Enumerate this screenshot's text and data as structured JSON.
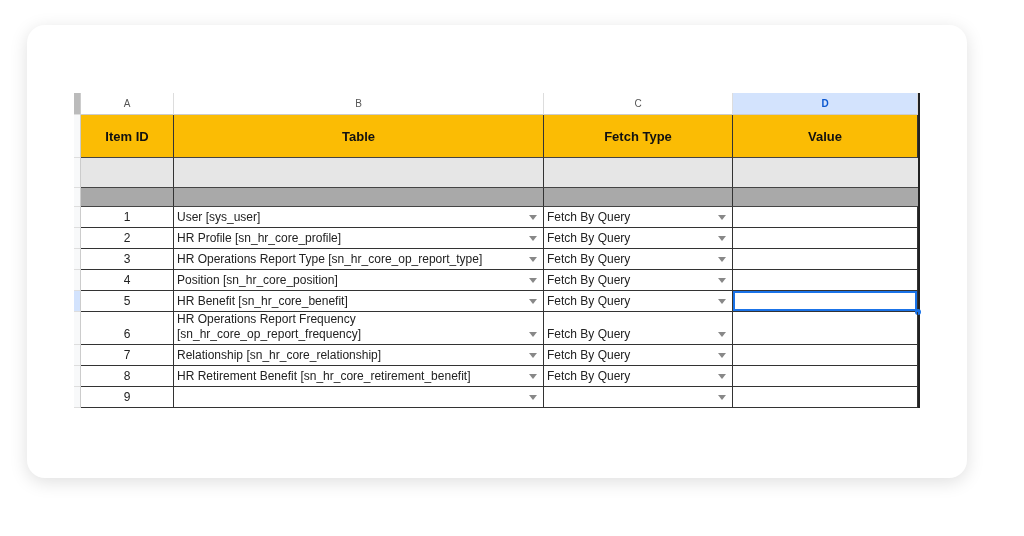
{
  "column_letters": [
    {
      "label": "A",
      "selected": false
    },
    {
      "label": "B",
      "selected": false
    },
    {
      "label": "C",
      "selected": false
    },
    {
      "label": "D",
      "selected": true
    }
  ],
  "header": [
    "Item ID",
    "Table",
    "Fetch Type",
    "Value"
  ],
  "bands": [
    {
      "color": "#e6e6e6"
    },
    {
      "color": "#a9a9a9"
    }
  ],
  "rows": [
    {
      "item_id": "1",
      "table": "User [sys_user]",
      "fetch_type": "Fetch By Query",
      "selected": false
    },
    {
      "item_id": "2",
      "table": "HR Profile [sn_hr_core_profile]",
      "fetch_type": "Fetch By Query",
      "selected": false
    },
    {
      "item_id": "3",
      "table": "HR Operations Report Type [sn_hr_core_op_report_type]",
      "fetch_type": "Fetch By Query",
      "selected": false
    },
    {
      "item_id": "4",
      "table": "Position [sn_hr_core_position]",
      "fetch_type": "Fetch By Query",
      "selected": false
    },
    {
      "item_id": "5",
      "table": "HR Benefit [sn_hr_core_benefit]",
      "fetch_type": "Fetch By Query",
      "selected": true
    },
    {
      "item_id": "6",
      "table": "HR Operations Report Frequency [sn_hr_core_op_report_frequency]",
      "fetch_type": "Fetch By Query",
      "selected": false
    },
    {
      "item_id": "7",
      "table": "Relationship [sn_hr_core_relationship]",
      "fetch_type": "Fetch By Query",
      "selected": false
    },
    {
      "item_id": "8",
      "table": "HR Retirement Benefit [sn_hr_core_retirement_benefit]",
      "fetch_type": "Fetch By Query",
      "selected": false
    },
    {
      "item_id": "9",
      "selected": false
    }
  ]
}
